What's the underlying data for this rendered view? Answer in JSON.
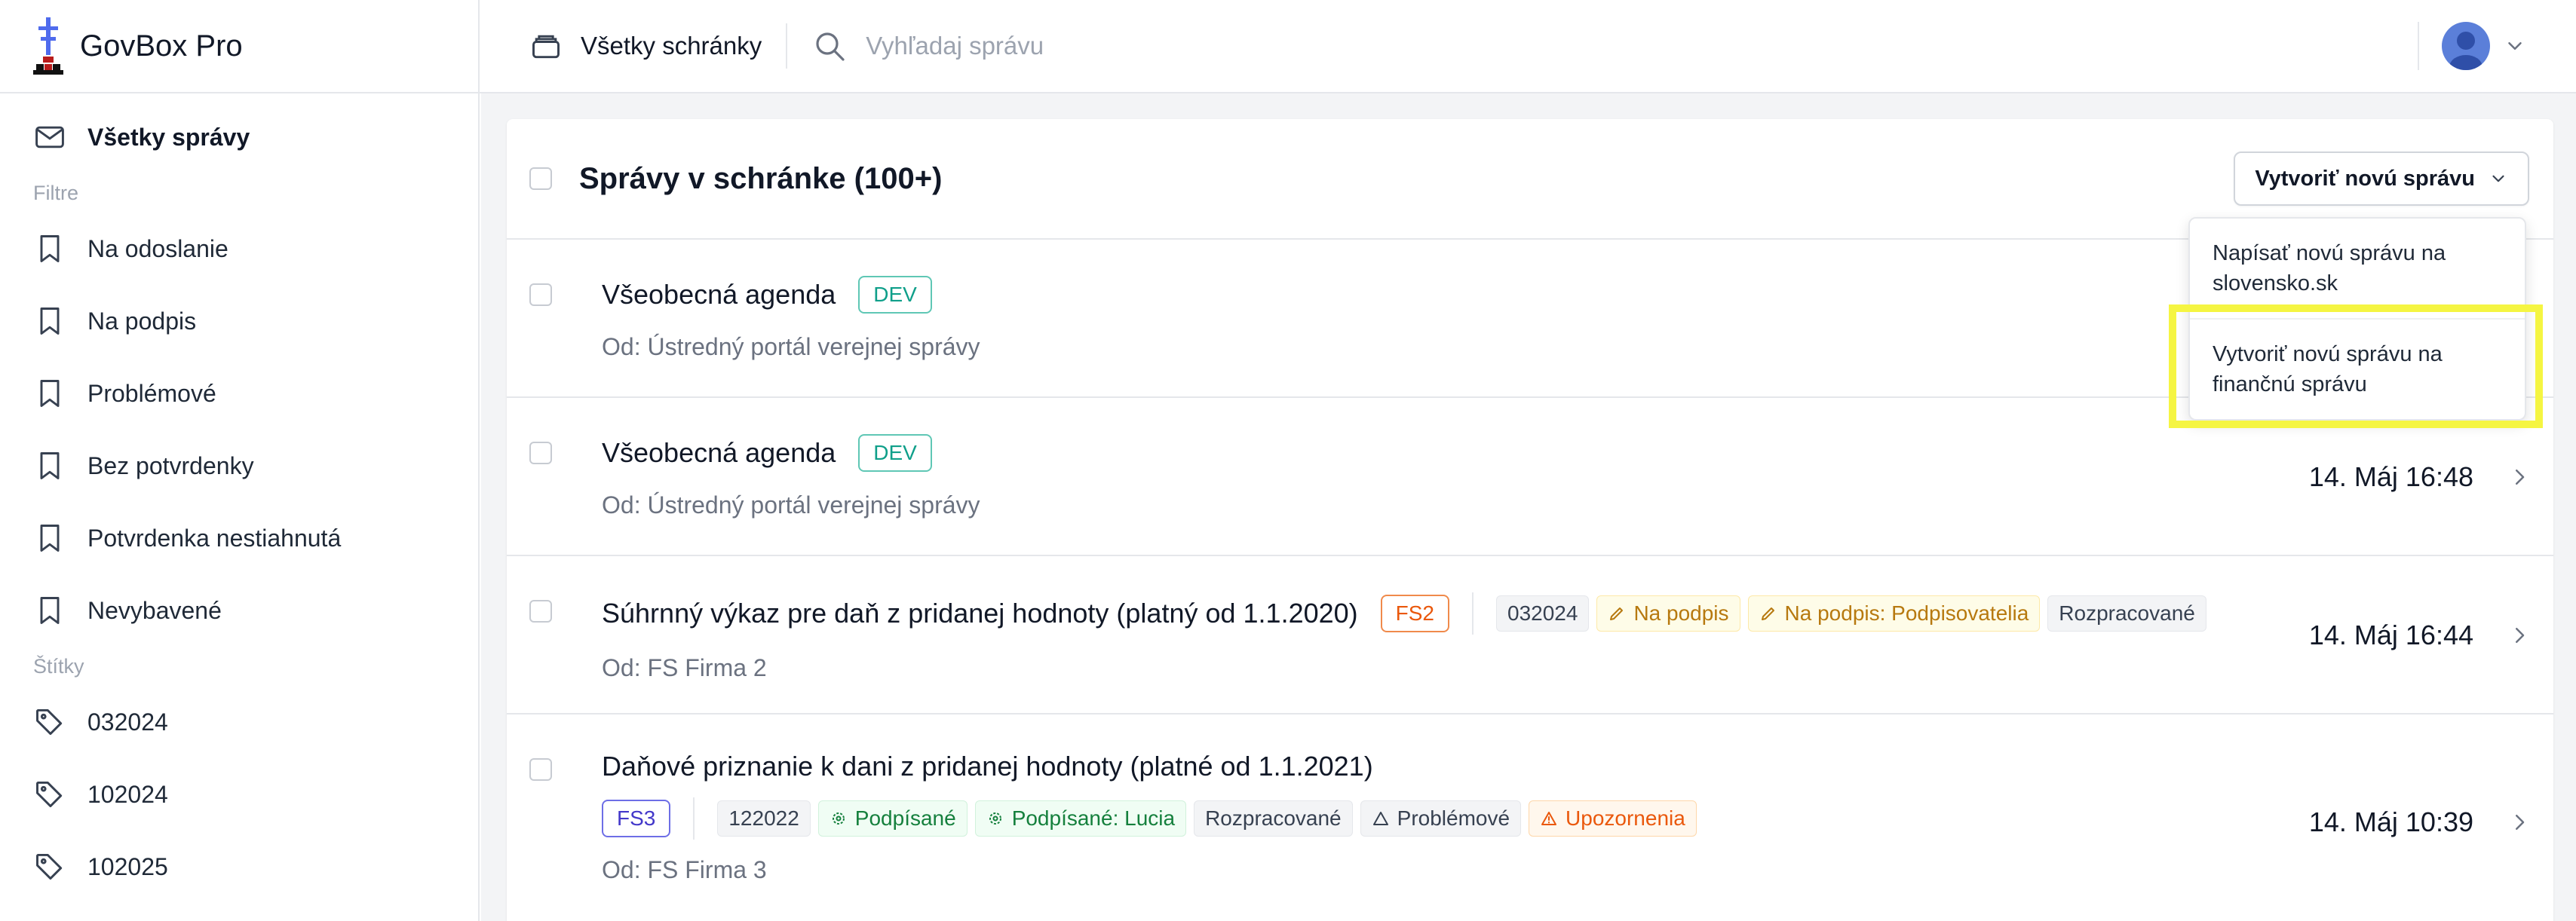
{
  "app": {
    "name": "GovBox Pro"
  },
  "sidebar": {
    "all_messages": "Všetky správy",
    "filters_heading": "Filtre",
    "filters": [
      "Na odoslanie",
      "Na podpis",
      "Problémové",
      "Bez potvrdenky",
      "Potvrdenka nestiahnutá",
      "Nevybavené"
    ],
    "tags_heading": "Štítky",
    "tags": [
      "032024",
      "102024",
      "102025"
    ]
  },
  "topbar": {
    "inbox_label": "Všetky schránky",
    "search_placeholder": "Vyhľadaj správu"
  },
  "main": {
    "title": "Správy v schránke (100+)",
    "new_message_button": "Vytvoriť novú správu",
    "dropdown": [
      "Napísať novú správu na slovensko.sk",
      "Vytvoriť novú správu na finančnú správu"
    ],
    "messages": [
      {
        "title": "Všeobecná agenda",
        "box": "DEV",
        "from": "Od: Ústredný portál verejnej správy",
        "date": ""
      },
      {
        "title": "Všeobecná agenda",
        "box": "DEV",
        "from": "Od: Ústredný portál verejnej správy",
        "date": "14. Máj 16:48"
      },
      {
        "title": "Súhrnný výkaz pre daň z pridanej hodnoty (platný od 1.1.2020)",
        "box": "FS2",
        "from": "Od: FS Firma 2",
        "date": "14. Máj 16:44",
        "chips": [
          "032024",
          "Na podpis",
          "Na podpis: Podpisovatelia",
          "Rozpracované"
        ]
      },
      {
        "title": "Daňové priznanie k dani z pridanej hodnoty (platné od 1.1.2021)",
        "box": "FS3",
        "from": "Od: FS Firma 3",
        "date": "14. Máj 10:39",
        "chips": [
          "122022",
          "Podpísané",
          "Podpísané: Lucia",
          "Rozpracované",
          "Problémové",
          "Upozornenia"
        ]
      }
    ]
  },
  "colors": {
    "highlight": "#f5f542",
    "brand_blue": "#4f6bed"
  }
}
